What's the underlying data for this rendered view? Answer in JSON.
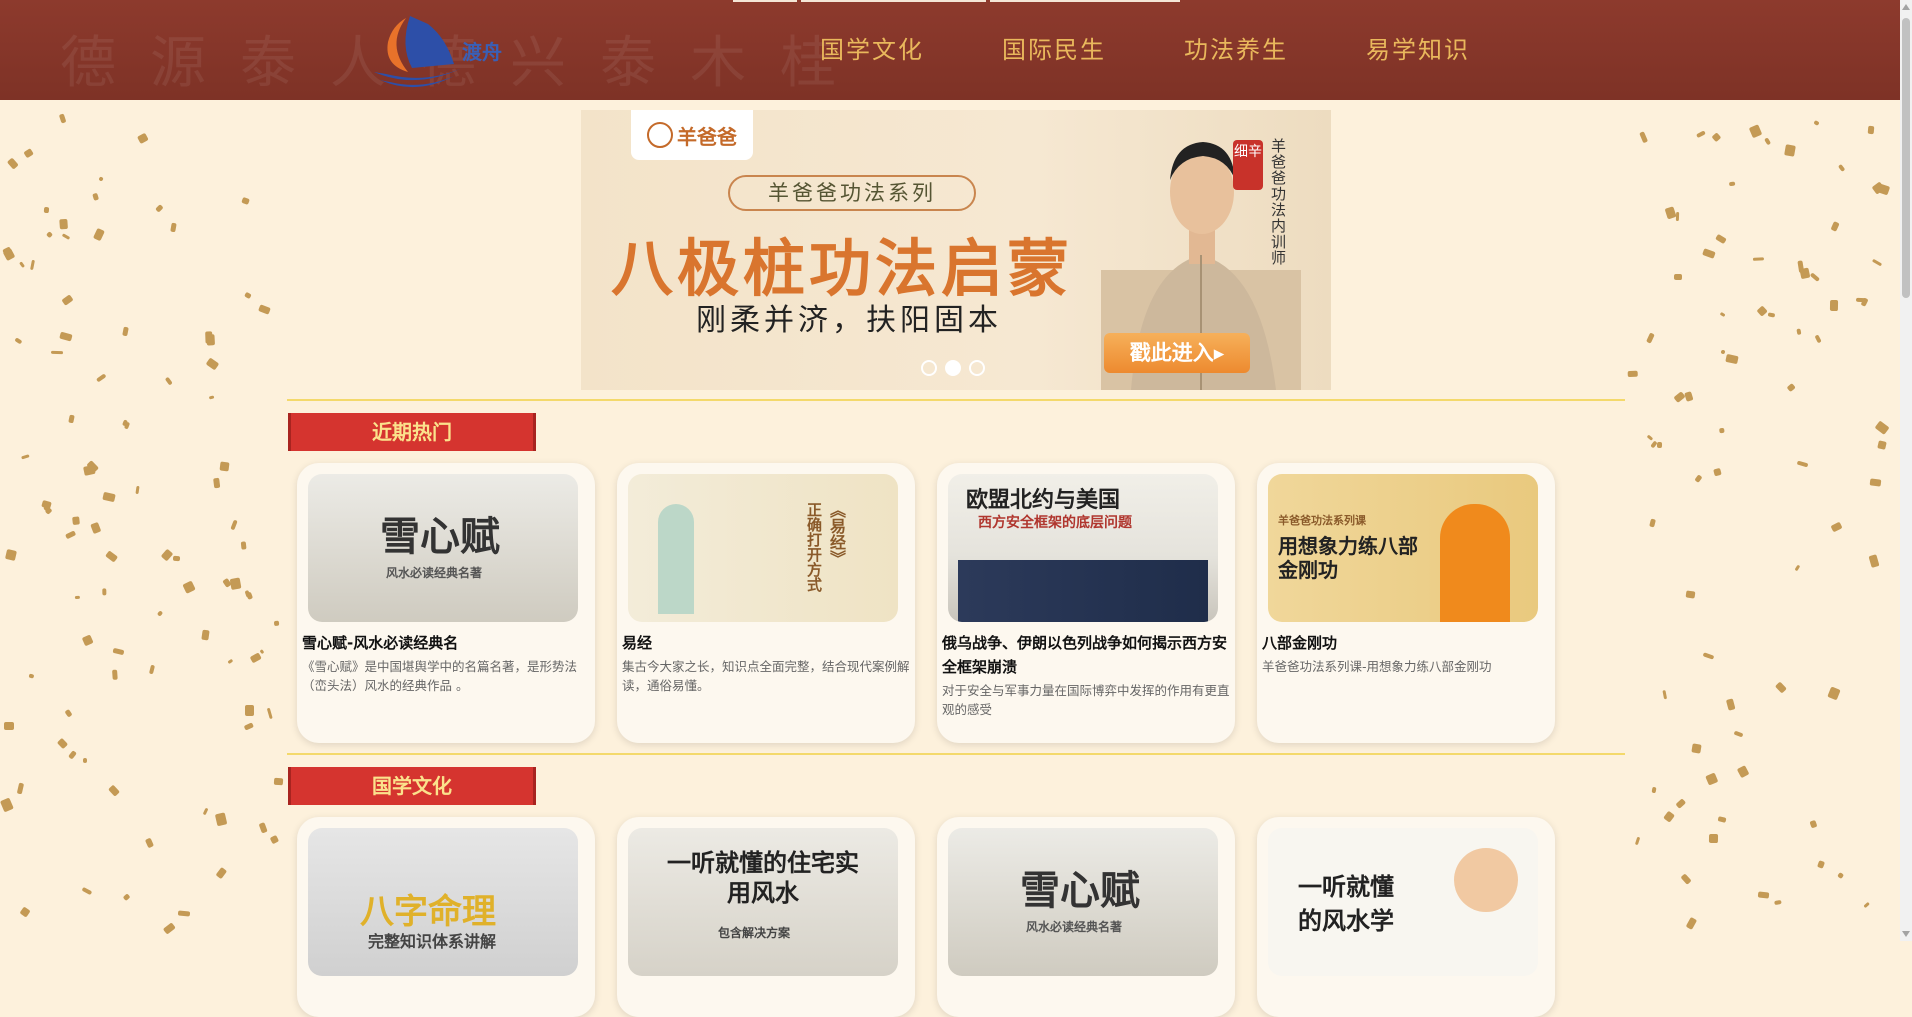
{
  "header": {
    "logo_text": "渡舟",
    "background_calligraphy": "德源泰人德兴泰木桂",
    "nav": [
      "国学文化",
      "国际民生",
      "功法养生",
      "易学知识"
    ]
  },
  "banner": {
    "brand": "羊爸爸",
    "series": "羊爸爸功法系列",
    "headline": "八极桩功法启蒙",
    "subtitle": "刚柔并济，扶阳固本",
    "vertical_title": "羊爸爸功法内训师",
    "seal": "细辛",
    "cta": "戳此进入▸",
    "slide_index": 2,
    "slide_count": 3
  },
  "sections": [
    {
      "title": "近期热门",
      "cards": [
        {
          "thumb_text": "雪心赋",
          "thumb_sub": "风水必读经典名著",
          "title": "雪心赋-风水必读经典名",
          "desc": "《雪心赋》是中国堪舆学中的名篇名著，是形势法（峦头法）风水的经典作品 。"
        },
        {
          "thumb_text": "《易经》",
          "thumb_sub": "正确打开方式",
          "title": "易经",
          "desc": "集古今大家之长，知识点全面完整，结合现代案例解读，通俗易懂。"
        },
        {
          "thumb_text": "欧盟北约与美国",
          "thumb_sub": "西方安全框架的底层问题",
          "title": "俄乌战争、伊朗以色列战争如何揭示西方安全框架崩溃",
          "desc": "对于安全与军事力量在国际博弈中发挥的作用有更直观的感受"
        },
        {
          "thumb_text": "用想象力练八部金刚功",
          "thumb_sub": "羊爸爸功法系列课",
          "title": "八部金刚功",
          "desc": "羊爸爸功法系列课-用想象力练八部金刚功"
        }
      ]
    },
    {
      "title": "国学文化",
      "cards": [
        {
          "thumb_text": "八字命理",
          "thumb_sub": "完整知识体系讲解"
        },
        {
          "thumb_text": "一听就懂的住宅实用风水",
          "thumb_sub": "包含解决方案"
        },
        {
          "thumb_text": "雪心赋",
          "thumb_sub": "风水必读经典名著"
        },
        {
          "thumb_text": "一听就懂的风水学",
          "thumb_sub": ""
        }
      ]
    }
  ],
  "colors": {
    "header_bg": "#8d3a2d",
    "nav_text": "#e9b85c",
    "section_title_bg": "#d5342f",
    "section_title_text": "#fbe28c",
    "page_bg": "#fdf1dc",
    "divider": "#f4d96b"
  }
}
